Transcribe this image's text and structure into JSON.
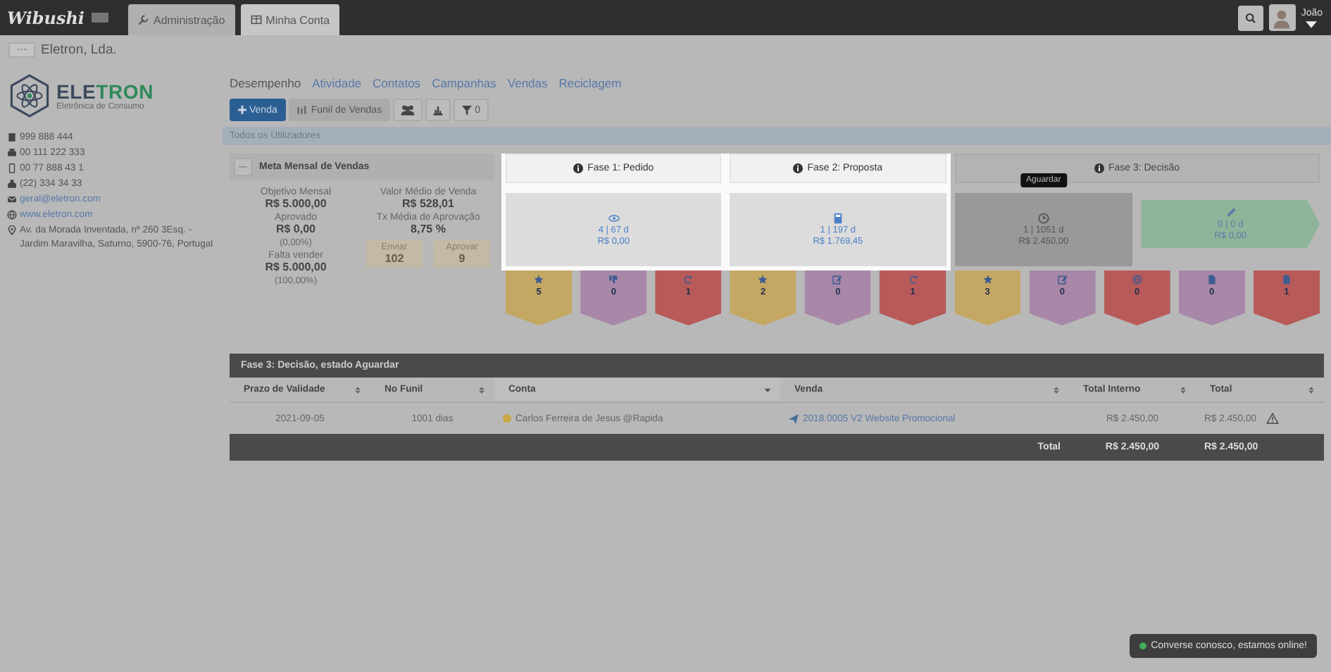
{
  "app": {
    "logo": "Wibushi"
  },
  "tabs": [
    {
      "label": "Administração",
      "selected": false
    },
    {
      "label": "Minha Conta",
      "selected": true
    }
  ],
  "user": {
    "name": "João"
  },
  "account": {
    "menu": "···",
    "name": "Eletron, Lda."
  },
  "company": {
    "logo_name": "ELETRON",
    "logo_tagline": "Eletrônica de Consumo",
    "contacts": [
      {
        "kind": "phone",
        "text": "999 888 444"
      },
      {
        "kind": "fax",
        "text": "00 111 222 333"
      },
      {
        "kind": "mobile",
        "text": "00 77 888 43 1"
      },
      {
        "kind": "office",
        "text": "(22) 334 34 33"
      },
      {
        "kind": "email",
        "text": "geral@eletron.com"
      },
      {
        "kind": "web",
        "text": "www.eletron.com"
      },
      {
        "kind": "address",
        "text": "Av. da Morada Inventada, nº 260 3Esq. - Jardim Maravilha, Saturno, 5900-76, Portugal"
      }
    ]
  },
  "nav_links": [
    {
      "label": "Desempenho",
      "selected": true
    },
    {
      "label": "Atividade",
      "selected": false
    },
    {
      "label": "Contatos",
      "selected": false
    },
    {
      "label": "Campanhas",
      "selected": false
    },
    {
      "label": "Vendas",
      "selected": false
    },
    {
      "label": "Reciclagem",
      "selected": false
    }
  ],
  "toolbar": {
    "new_sale": "Venda",
    "funnel": "Funil de Vendas",
    "filter_count": "0"
  },
  "user_filter": "Todos os Utilizadores",
  "goal_panel": {
    "toggle": "—",
    "title": "Meta Mensal de Vendas",
    "metrics_left": [
      {
        "label": "Objetivo Mensal",
        "value": "R$ 5.000,00"
      },
      {
        "label": "Aprovado",
        "value": "R$ 0,00",
        "note": "(0,00%)"
      },
      {
        "label": "Falta vender",
        "value": "R$ 5.000,00",
        "note": "(100,00%)"
      }
    ],
    "metrics_right": [
      {
        "label": "Valor Médio de Venda",
        "value": "R$ 528,01"
      },
      {
        "label": "Tx Média de Aprovação",
        "value": "8,75 %"
      }
    ],
    "counters": [
      {
        "label": "Enviar",
        "value": "102"
      },
      {
        "label": "Aprovar",
        "value": "9"
      }
    ]
  },
  "phases": [
    {
      "title": "Fase 1: Pedido",
      "highlighted": true,
      "cards": [
        {
          "kind": "eye",
          "count": "4 | 67 d",
          "amount": "R$ 0,00",
          "selected": false
        }
      ],
      "tags": [
        {
          "kind": "star",
          "count": "5",
          "color": "#c4a763"
        },
        {
          "kind": "thumb",
          "count": "0",
          "color": "#a887a8"
        },
        {
          "kind": "refresh",
          "count": "1",
          "color": "#b85a5a"
        }
      ]
    },
    {
      "title": "Fase 2: Proposta",
      "highlighted": true,
      "cards": [
        {
          "kind": "calculator",
          "count": "1 | 197 d",
          "amount": "R$ 1.769,45",
          "selected": false
        }
      ],
      "tags": [
        {
          "kind": "star",
          "count": "2",
          "color": "#c4a763"
        },
        {
          "kind": "edit",
          "count": "0",
          "color": "#a887a8"
        },
        {
          "kind": "refresh",
          "count": "1",
          "color": "#b85a5a"
        }
      ]
    },
    {
      "title": "Fase 3: Decisão",
      "highlighted": false,
      "cards": [
        {
          "kind": "clock",
          "count": "1 | 1051 d",
          "amount": "R$ 2.450,00",
          "selected": true,
          "tooltip": "Aguardar"
        },
        {
          "kind": "arrow",
          "count": "0 | 0 d",
          "amount": "R$ 0,00",
          "selected": false
        }
      ],
      "tags": [
        {
          "kind": "star",
          "count": "3",
          "color": "#c4a763"
        },
        {
          "kind": "edit",
          "count": "0",
          "color": "#a887a8"
        },
        {
          "kind": "globe",
          "count": "0",
          "color": "#b85a5a"
        },
        {
          "kind": "doc",
          "count": "0",
          "color": "#a887a8"
        },
        {
          "kind": "doc",
          "count": "1",
          "color": "#b85a5a"
        }
      ]
    }
  ],
  "table": {
    "title": "Fase 3: Decisão, estado Aguardar",
    "columns": [
      {
        "label": "Prazo de Validade",
        "sorted": false
      },
      {
        "label": "No Funil",
        "sorted": false
      },
      {
        "label": "Conta",
        "sorted": true
      },
      {
        "label": "Venda",
        "sorted": false
      },
      {
        "label": "Total Interno",
        "sorted": false
      },
      {
        "label": "Total",
        "sorted": false
      }
    ],
    "rows": [
      {
        "date": "2021-09-05",
        "days": "1001 dias",
        "account": "Carlos Ferreira de Jesus @Rapida",
        "color": "#c8a840",
        "sale": "2018.0005 V2 Website Promocional",
        "internal_total": "R$ 2.450,00",
        "total": "R$ 2.450,00",
        "warning": true
      }
    ],
    "footer": {
      "label": "Total",
      "internal_total": "R$ 2.450,00",
      "total": "R$ 2.450,00"
    }
  },
  "chat": {
    "text": "Converse conosco, estamos online!",
    "online": true
  }
}
